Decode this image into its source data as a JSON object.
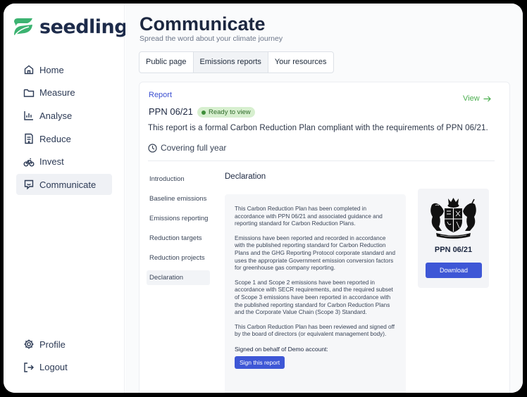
{
  "app": {
    "name": "seedling",
    "brand_color": "#3cb371",
    "accent_color": "#3e57d6"
  },
  "sidebar": {
    "items": [
      {
        "label": "Home",
        "icon": "home-icon"
      },
      {
        "label": "Measure",
        "icon": "folder-icon"
      },
      {
        "label": "Analyse",
        "icon": "chart-icon"
      },
      {
        "label": "Reduce",
        "icon": "document-icon"
      },
      {
        "label": "Invest",
        "icon": "bicycle-icon"
      },
      {
        "label": "Communicate",
        "icon": "chat-icon",
        "active": true
      }
    ],
    "bottom": [
      {
        "label": "Profile",
        "icon": "gear-icon"
      },
      {
        "label": "Logout",
        "icon": "logout-icon"
      }
    ]
  },
  "page": {
    "title": "Communicate",
    "subtitle": "Spread the word about your climate journey",
    "tabs": [
      {
        "label": "Public page"
      },
      {
        "label": "Emissions reports",
        "active": true
      },
      {
        "label": "Your resources"
      }
    ]
  },
  "report": {
    "label": "Report",
    "view_link": "View",
    "title": "PPN 06/21",
    "status": "Ready to view",
    "description": "This report is a formal Carbon Reduction Plan compliant with the requirements of PPN 06/21.",
    "period": "Covering full year",
    "toc": [
      {
        "label": "Introduction"
      },
      {
        "label": "Baseline emissions"
      },
      {
        "label": "Emissions reporting"
      },
      {
        "label": "Reduction targets"
      },
      {
        "label": "Reduction projects"
      },
      {
        "label": "Declaration",
        "active": true
      }
    ],
    "section_title": "Declaration",
    "declaration": [
      "This Carbon Reduction Plan has been completed in accordance with PPN 06/21 and associated guidance and reporting standard for Carbon Reduction Plans.",
      "Emissions have been reported and recorded in accordance with the published reporting standard for Carbon Reduction Plans and the GHG Reporting Protocol corporate standard  and uses the appropriate Government emission conversion factors for greenhouse gas company reporting.",
      "Scope 1 and Scope 2 emissions have been reported in accordance with SECR requirements, and the required subset of Scope 3 emissions have been reported in accordance with the published reporting standard for Carbon Reduction Plans and the Corporate Value Chain (Scope 3) Standard.",
      "This Carbon Reduction Plan has been reviewed and signed off by the board of directors (or equivalent management body)."
    ],
    "signed_label": "Signed on behalf of Demo account:",
    "sign_button": "Sign this report",
    "crest_label": "PPN 06/21",
    "download_button": "Download"
  }
}
